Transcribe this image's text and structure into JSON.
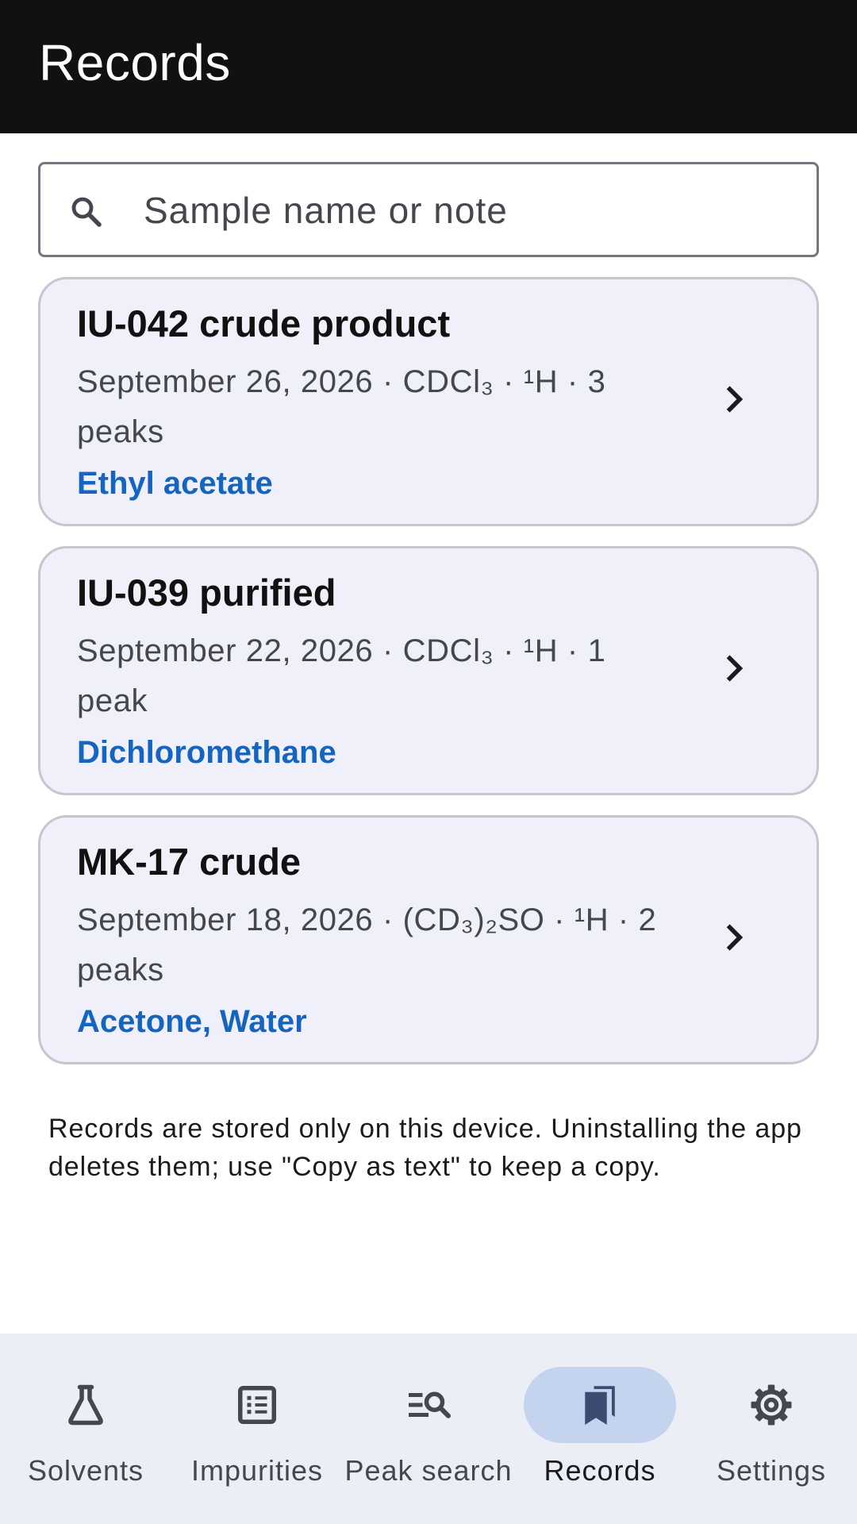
{
  "app_bar": {
    "title": "Records"
  },
  "search": {
    "placeholder": "Sample name or note",
    "value": ""
  },
  "records": [
    {
      "name": "IU-042 crude product",
      "meta": "September 26, 2026 · CDCl₃ · ¹H · 3 peaks",
      "impurities": "Ethyl acetate"
    },
    {
      "name": "IU-039 purified",
      "meta": "September 22, 2026 · CDCl₃ · ¹H · 1 peak",
      "impurities": "Dichloromethane"
    },
    {
      "name": "MK-17 crude",
      "meta": "September 18, 2026 · (CD₃)₂SO · ¹H · 2 peaks",
      "impurities": "Acetone, Water"
    }
  ],
  "storage_note": "Records are stored only on this device. Uninstalling the app deletes them; use \"Copy as text\" to keep a copy.",
  "nav": [
    {
      "label": "Solvents",
      "icon": "flask-icon"
    },
    {
      "label": "Impurities",
      "icon": "list-icon"
    },
    {
      "label": "Peak search",
      "icon": "search-list-icon"
    },
    {
      "label": "Records",
      "icon": "bookmarks-icon",
      "active": true
    },
    {
      "label": "Settings",
      "icon": "gear-icon"
    }
  ],
  "colors": {
    "app_bar": "#111111",
    "card_bg": "#eff0f9",
    "impurity_text": "#1565c0",
    "nav_bg": "#eceef5",
    "active_pill": "#c4d3ee"
  }
}
